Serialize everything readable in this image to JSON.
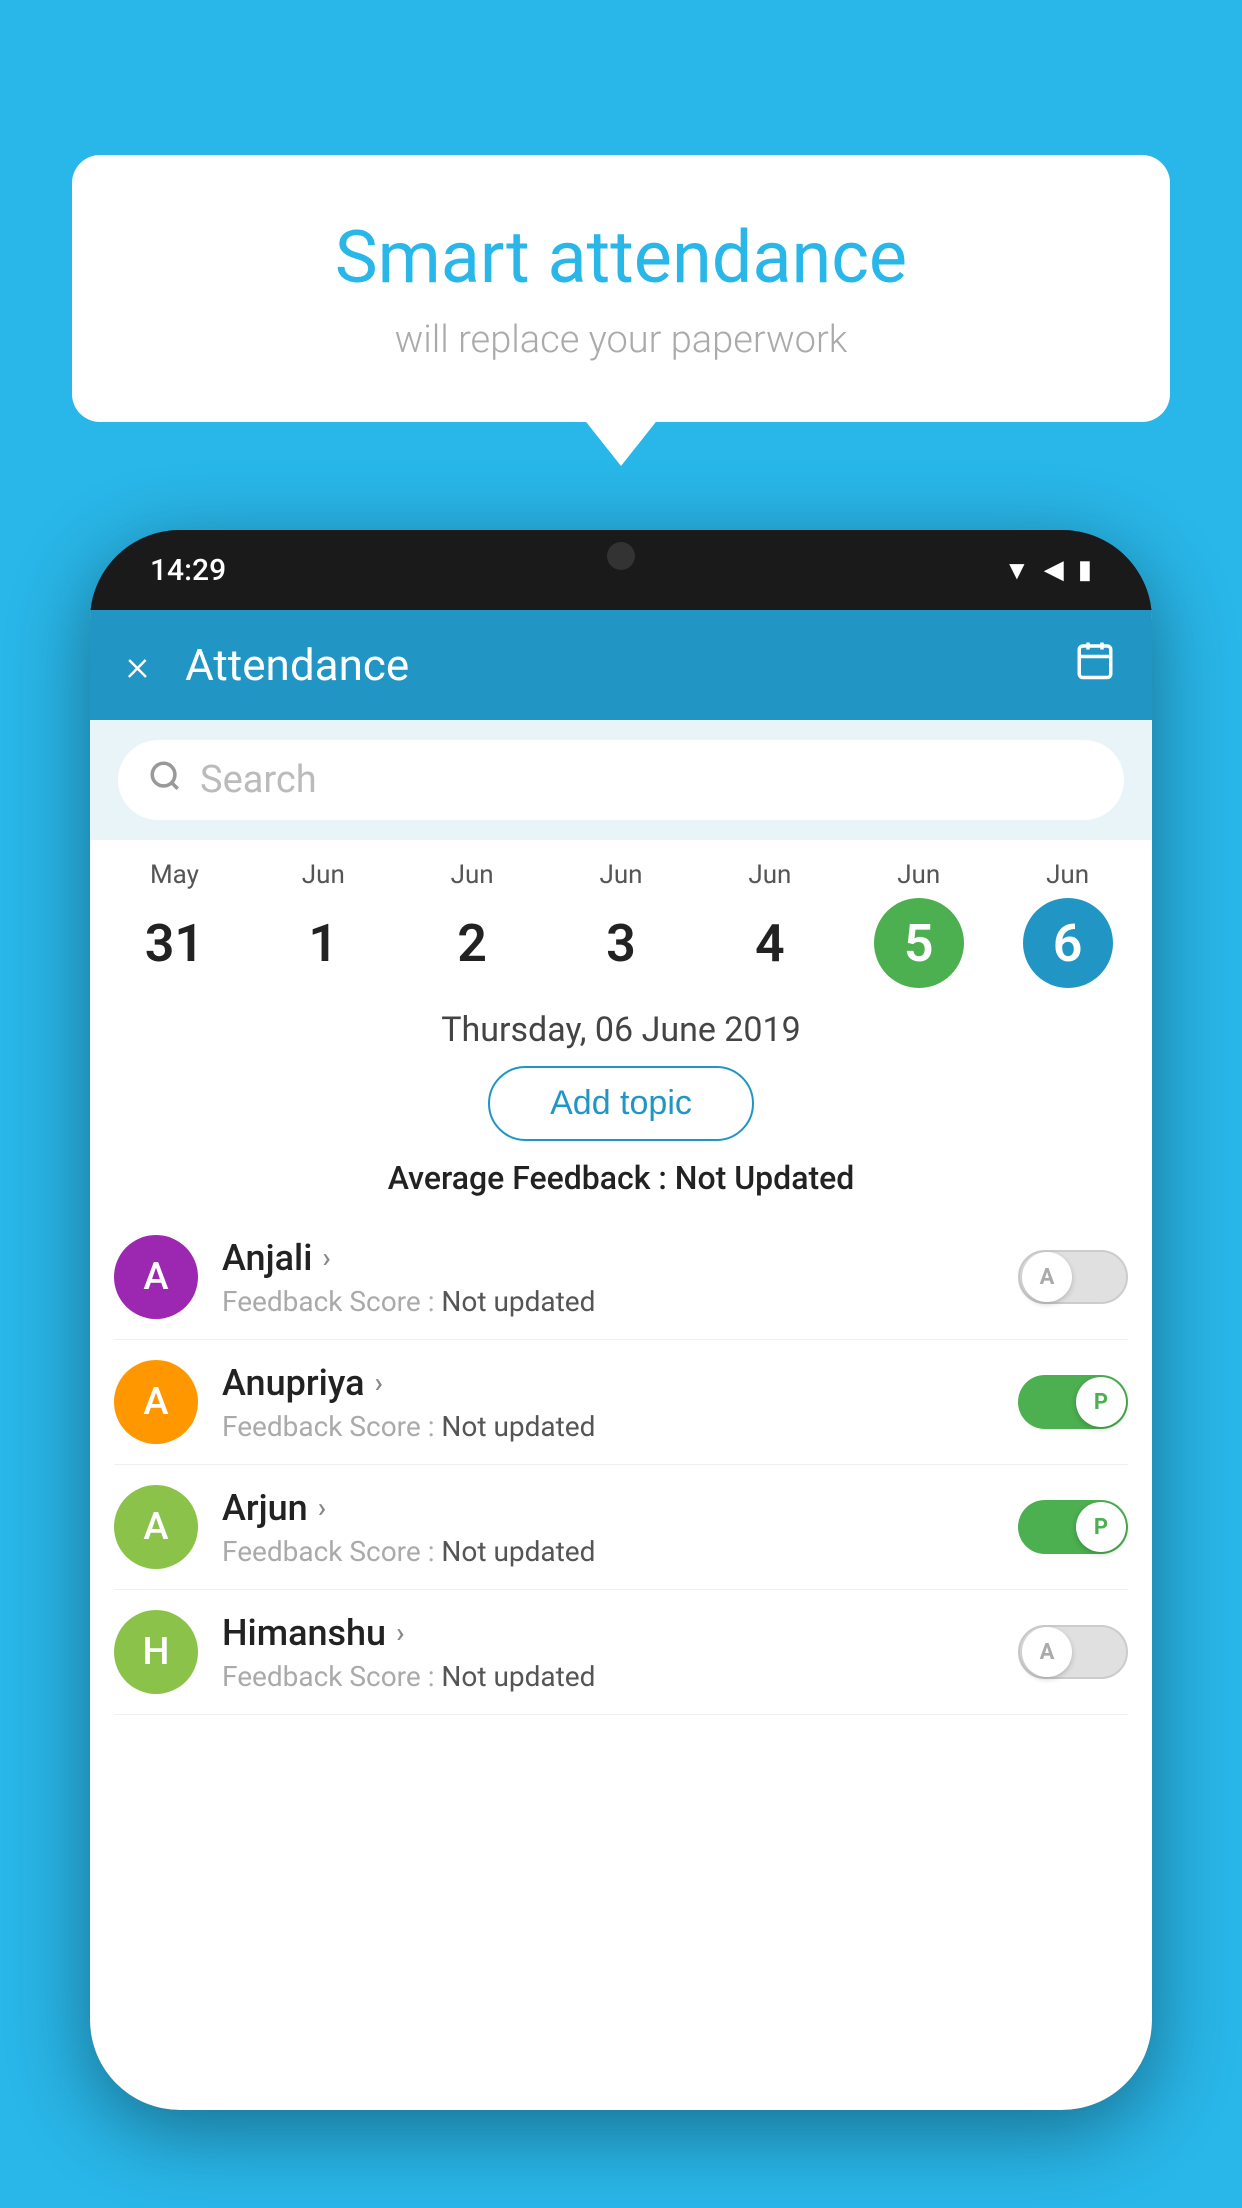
{
  "background_color": "#29b6e8",
  "bubble": {
    "title": "Smart attendance",
    "subtitle": "will replace your paperwork"
  },
  "phone": {
    "status_time": "14:29",
    "app_bar": {
      "title": "Attendance",
      "close_label": "×",
      "calendar_icon": "📅"
    },
    "search": {
      "placeholder": "Search"
    },
    "calendar": {
      "days": [
        {
          "month": "May",
          "date": "31",
          "state": "normal"
        },
        {
          "month": "Jun",
          "date": "1",
          "state": "normal"
        },
        {
          "month": "Jun",
          "date": "2",
          "state": "normal"
        },
        {
          "month": "Jun",
          "date": "3",
          "state": "normal"
        },
        {
          "month": "Jun",
          "date": "4",
          "state": "normal"
        },
        {
          "month": "Jun",
          "date": "5",
          "state": "today"
        },
        {
          "month": "Jun",
          "date": "6",
          "state": "selected"
        }
      ]
    },
    "selected_date": "Thursday, 06 June 2019",
    "add_topic_label": "Add topic",
    "avg_feedback_label": "Average Feedback :",
    "avg_feedback_value": "Not Updated",
    "students": [
      {
        "name": "Anjali",
        "avatar_letter": "A",
        "avatar_color": "#9c27b0",
        "feedback_label": "Feedback Score :",
        "feedback_value": "Not updated",
        "toggle_state": "off",
        "toggle_letter": "A"
      },
      {
        "name": "Anupriya",
        "avatar_letter": "A",
        "avatar_color": "#ff9800",
        "feedback_label": "Feedback Score :",
        "feedback_value": "Not updated",
        "toggle_state": "on",
        "toggle_letter": "P"
      },
      {
        "name": "Arjun",
        "avatar_letter": "A",
        "avatar_color": "#8bc34a",
        "feedback_label": "Feedback Score :",
        "feedback_value": "Not updated",
        "toggle_state": "on",
        "toggle_letter": "P"
      },
      {
        "name": "Himanshu",
        "avatar_letter": "H",
        "avatar_color": "#8bc34a",
        "feedback_label": "Feedback Score :",
        "feedback_value": "Not updated",
        "toggle_state": "off",
        "toggle_letter": "A"
      }
    ]
  }
}
